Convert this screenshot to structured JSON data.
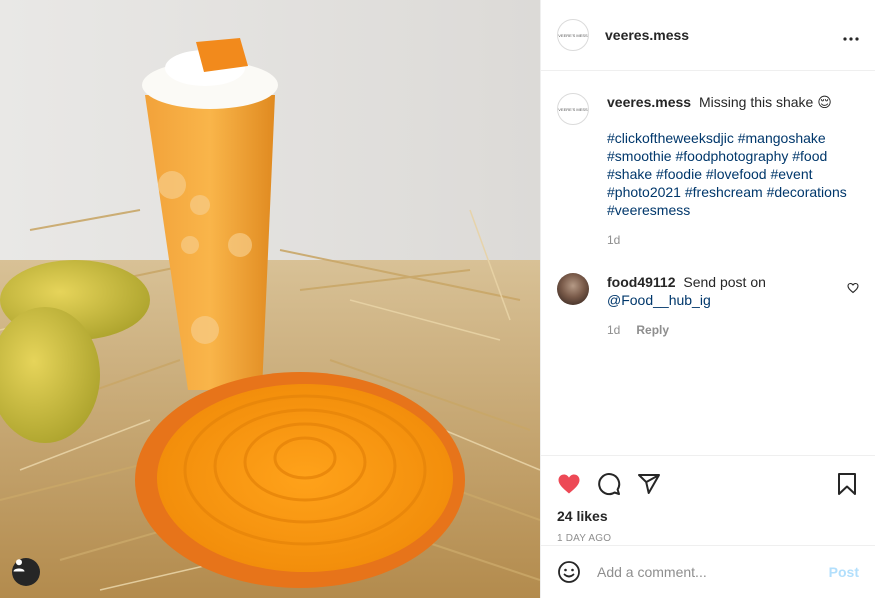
{
  "post": {
    "author": "veeres.mess",
    "avatar_logo_text": "VEERE'S MESS",
    "more_icon": "more-horizontal-icon"
  },
  "caption": {
    "username": "veeres.mess",
    "text": "Missing this shake 😌",
    "hashtags": [
      "#clickoftheweeksdjic",
      "#mangoshake",
      "#smoothie",
      "#foodphotography",
      "#food",
      "#shake",
      "#foodie",
      "#lovefood",
      "#event",
      "#photo2021",
      "#freshcream",
      "#decorations",
      "#veeresmess"
    ],
    "age": "1d"
  },
  "comments": [
    {
      "username": "food49112",
      "text": "Send post on",
      "mention": "@Food__hub_ig",
      "age": "1d",
      "reply_label": "Reply"
    }
  ],
  "actions": {
    "like_icon": "heart-filled-icon",
    "comment_icon": "comment-icon",
    "share_icon": "send-icon",
    "save_icon": "bookmark-icon",
    "like_color": "#ed4956"
  },
  "likes": "24 likes",
  "timestamp": "1 DAY AGO",
  "composer": {
    "placeholder": "Add a comment...",
    "post_label": "Post",
    "emoji_icon": "emoji-icon"
  },
  "colors": {
    "link": "#00376b",
    "muted": "#8e8e8e",
    "post_disabled": "#b2dffc"
  }
}
